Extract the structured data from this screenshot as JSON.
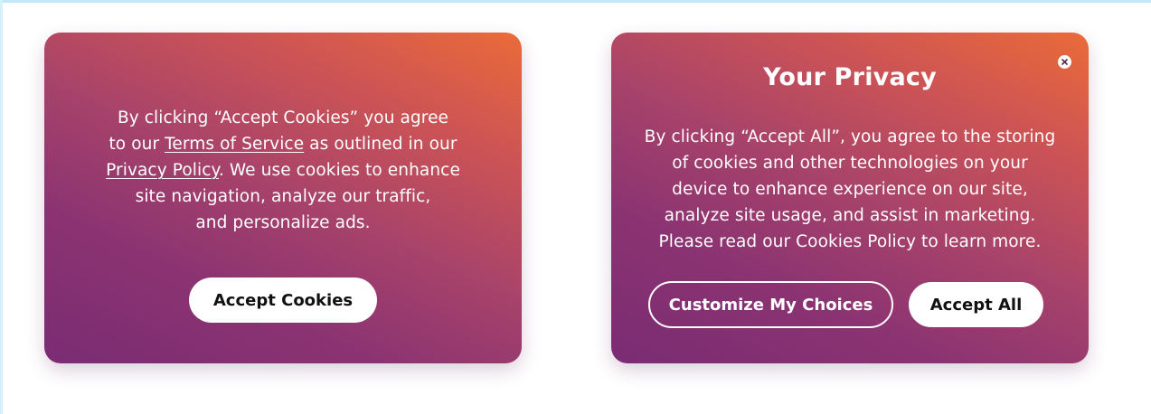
{
  "left_banner": {
    "text_1": "By clicking “Accept Cookies” you agree",
    "text_2": "to our ",
    "terms_link": "Terms of Service",
    "text_3": " as outlined in our",
    "privacy_link": "Privacy Policy",
    "text_4": ". We use cookies to enhance",
    "text_5": "site navigation, analyze our traffic,",
    "text_6": "and personalize ads.",
    "accept_label": "Accept Cookies"
  },
  "right_banner": {
    "title": "Your Privacy",
    "lines": [
      "By clicking “Accept All”, you agree to the storing",
      "of cookies and other technologies on your",
      "device to enhance experience on our site,",
      "analyze site usage, and assist in marketing.",
      "Please read our Cookies Policy to learn more."
    ],
    "customize_label": "Customize My Choices",
    "accept_all_label": "Accept All",
    "close_icon": "close-icon"
  },
  "colors": {
    "gradient_orange": "#ea6b38",
    "gradient_purple": "#7a2c73",
    "button_bg": "#ffffff",
    "button_text": "#111111"
  }
}
